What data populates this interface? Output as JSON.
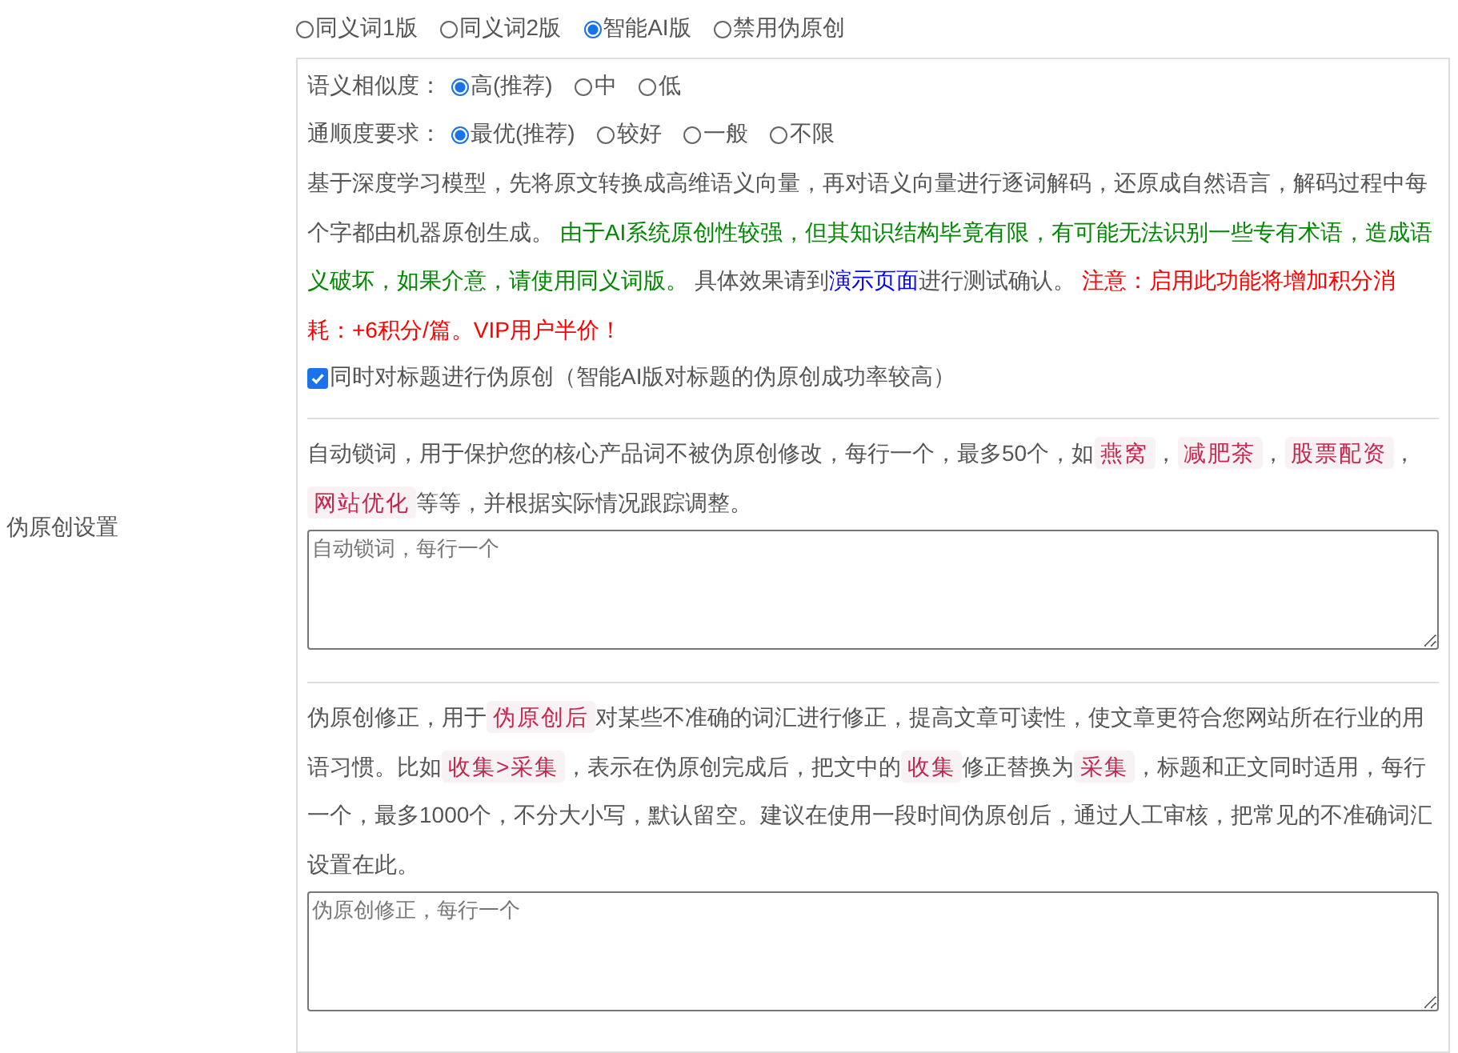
{
  "section_label": "伪原创设置",
  "modes": [
    {
      "label": "同义词1版",
      "selected": false
    },
    {
      "label": "同义词2版",
      "selected": false
    },
    {
      "label": "智能AI版",
      "selected": true
    },
    {
      "label": "禁用伪原创",
      "selected": false
    }
  ],
  "similarity": {
    "label": "语义相似度：",
    "options": [
      {
        "label": "高(推荐)",
        "selected": true
      },
      {
        "label": "中",
        "selected": false
      },
      {
        "label": "低",
        "selected": false
      }
    ]
  },
  "fluency": {
    "label": "通顺度要求：",
    "options": [
      {
        "label": "最优(推荐)",
        "selected": true
      },
      {
        "label": "较好",
        "selected": false
      },
      {
        "label": "一般",
        "selected": false
      },
      {
        "label": "不限",
        "selected": false
      }
    ]
  },
  "ai_description": [
    {
      "kind": "plain",
      "text": "基于深度学习模型，先将原文转换成高维语义向量，再对语义向量进行逐词解码，还原成自然语言，解码过程中每个字都由机器原创生成。 "
    },
    {
      "kind": "green",
      "text": "由于AI系统原创性较强，但其知识结构毕竟有限，有可能无法识别一些专有术语，造成语义破坏，如果介意，请使用同义词版。"
    },
    {
      "kind": "plain",
      "text": " 具体效果请到"
    },
    {
      "kind": "link",
      "text": "演示页面"
    },
    {
      "kind": "plain",
      "text": "进行测试确认。 "
    },
    {
      "kind": "red",
      "text": "注意：启用此功能将增加积分消耗：+6积分/篇。VIP用户半价！"
    }
  ],
  "title_option": {
    "label": "同时对标题进行伪原创（智能AI版对标题的伪原创成功率较高）",
    "checked": true
  },
  "lock_words": {
    "description": [
      {
        "kind": "plain",
        "text": "自动锁词，用于保护您的核心产品词不被伪原创修改，每行一个，最多50个，如"
      },
      {
        "kind": "tag",
        "text": "燕窝"
      },
      {
        "kind": "plain",
        "text": "，"
      },
      {
        "kind": "tag",
        "text": "减肥茶"
      },
      {
        "kind": "plain",
        "text": "，"
      },
      {
        "kind": "tag",
        "text": "股票配资"
      },
      {
        "kind": "plain",
        "text": "，"
      },
      {
        "kind": "tag",
        "text": "网站优化"
      },
      {
        "kind": "plain",
        "text": "等等，并根据实际情况跟踪调整。"
      }
    ],
    "placeholder": "自动锁词，每行一个"
  },
  "corrections": {
    "description": [
      {
        "kind": "plain",
        "text": "伪原创修正，用于"
      },
      {
        "kind": "tag",
        "text": "伪原创后"
      },
      {
        "kind": "plain",
        "text": "对某些不准确的词汇进行修正，提高文章可读性，使文章更符合您网站所在行业的用语习惯。比如"
      },
      {
        "kind": "tag",
        "text": "收集>采集"
      },
      {
        "kind": "plain",
        "text": "，表示在伪原创完成后，把文中的"
      },
      {
        "kind": "tag",
        "text": "收集"
      },
      {
        "kind": "plain",
        "text": "修正替换为"
      },
      {
        "kind": "tag",
        "text": "采集"
      },
      {
        "kind": "plain",
        "text": "，标题和正文同时适用，每行一个，最多1000个，不分大小写，默认留空。建议在使用一段时间伪原创后，通过人工审核，把常见的不准确词汇设置在此。"
      }
    ],
    "placeholder": "伪原创修正，每行一个"
  }
}
